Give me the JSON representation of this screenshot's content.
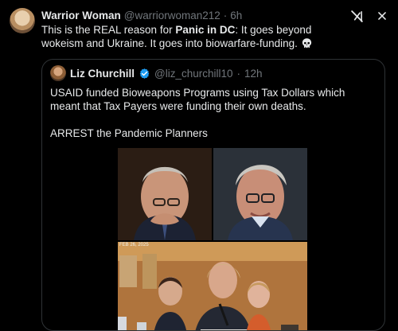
{
  "post": {
    "author_name": "Warrior Woman",
    "author_handle": "@warriorwoman212",
    "separator": "·",
    "time": "6h",
    "text_prefix": "This is the REAL reason for ",
    "text_bold": "Panic in DC",
    "text_suffix": ": It goes beyond wokeism and Ukraine. It goes into biowarfare-funding.",
    "emoji_icon": "skull-icon"
  },
  "icons": {
    "grok": "grok-icon",
    "close": "close-icon"
  },
  "quote": {
    "author_name": "Liz Churchill",
    "author_handle": "@liz_churchill10",
    "separator": "·",
    "time": "12h",
    "verified_icon": "verified-badge-icon",
    "line1": "USAID funded Bioweapons Programs using Tax Dollars which meant that Tax Payers were funding their own deaths.",
    "line2": "ARREST the Pandemic Planners",
    "photo_caption": "FEB 26, 2025"
  },
  "colors": {
    "background": "#000000",
    "text": "#e7e9ea",
    "muted": "#71767b",
    "verified": "#1d9bf0",
    "border": "#2f3336"
  }
}
